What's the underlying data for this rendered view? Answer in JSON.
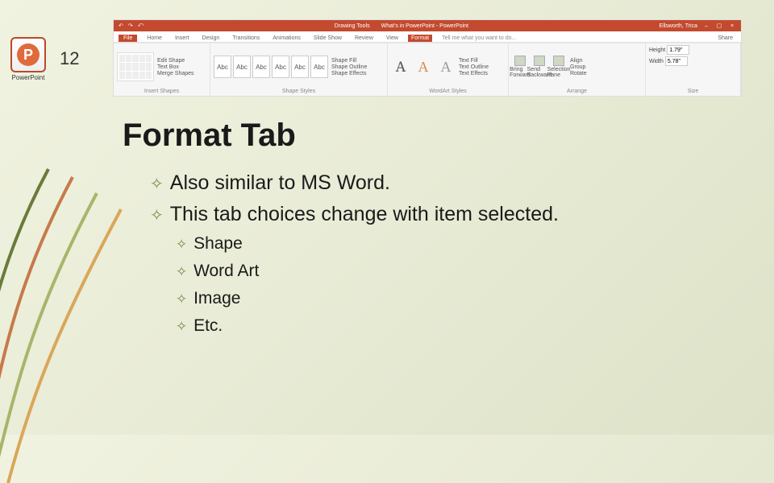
{
  "slide_number": "12",
  "logo": {
    "letter": "P",
    "caption": "PowerPoint"
  },
  "ribbon": {
    "titlebar": {
      "left_items": [
        "↶",
        "↷",
        "⤺"
      ],
      "center_groups": [
        "Drawing Tools",
        "What's in PowerPoint - PowerPoint"
      ],
      "right_user": "Ellsworth, Trica",
      "win_buttons": [
        "–",
        "▢",
        "×"
      ]
    },
    "tabs": {
      "file": "File",
      "items": [
        "Home",
        "Insert",
        "Design",
        "Transitions",
        "Animations",
        "Slide Show",
        "Review",
        "View"
      ],
      "active": "Format",
      "tell_me": "Tell me what you want to do...",
      "share": "Share"
    },
    "groups": {
      "insert_shapes": {
        "label": "Insert Shapes",
        "edit_shape": "Edit Shape",
        "text_box": "Text Box",
        "merge": "Merge Shapes"
      },
      "shape_styles": {
        "label": "Shape Styles",
        "abc": "Abc",
        "fill": "Shape Fill",
        "outline": "Shape Outline",
        "effects": "Shape Effects"
      },
      "wordart": {
        "label": "WordArt Styles",
        "letter": "A",
        "fill": "Text Fill",
        "outline": "Text Outline",
        "effects": "Text Effects"
      },
      "arrange": {
        "label": "Arrange",
        "bring": "Bring Forward",
        "send": "Send Backward",
        "selection": "Selection Pane",
        "align": "Align",
        "group": "Group",
        "rotate": "Rotate"
      },
      "size": {
        "label": "Size",
        "height_label": "Height",
        "height": "1.79\"",
        "width_label": "Width",
        "width": "5.78\""
      }
    }
  },
  "content": {
    "heading": "Format Tab",
    "points_lvl1": [
      "Also similar to MS Word.",
      "This tab choices change with item selected."
    ],
    "points_lvl2": [
      "Shape",
      "Word Art",
      "Image",
      "Etc."
    ]
  }
}
